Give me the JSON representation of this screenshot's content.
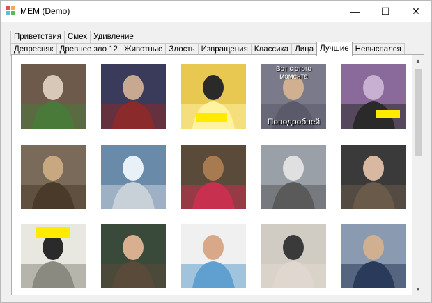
{
  "window": {
    "title": "MEM (Demo)"
  },
  "controls": {
    "minimize": "—",
    "maximize": "☐",
    "close": "✕"
  },
  "tabs_row1": [
    {
      "label": "Приветствия"
    },
    {
      "label": "Смех"
    },
    {
      "label": "Удивление"
    }
  ],
  "tabs_row2": [
    {
      "label": "Депресняк"
    },
    {
      "label": "Древнее зло 12"
    },
    {
      "label": "Животные"
    },
    {
      "label": "Злость"
    },
    {
      "label": "Извращения"
    },
    {
      "label": "Классика"
    },
    {
      "label": "Лица"
    },
    {
      "label": "Лучшие",
      "active": true
    },
    {
      "label": "Невыспался"
    }
  ],
  "memes": [
    {
      "caption_top": "",
      "caption_bottom": ""
    },
    {
      "caption_top": "",
      "caption_bottom": ""
    },
    {
      "caption_top": "",
      "caption_bottom": ""
    },
    {
      "caption_top": "Вот с этого момента",
      "caption_bottom": "Поподробней"
    },
    {
      "caption_top": "",
      "caption_bottom": ""
    },
    {
      "caption_top": "",
      "caption_bottom": ""
    },
    {
      "caption_top": "",
      "caption_bottom": ""
    },
    {
      "caption_top": "",
      "caption_bottom": ""
    },
    {
      "caption_top": "",
      "caption_bottom": ""
    },
    {
      "caption_top": "",
      "caption_bottom": ""
    },
    {
      "caption_top": "",
      "caption_bottom": ""
    },
    {
      "caption_top": "",
      "caption_bottom": ""
    },
    {
      "caption_top": "",
      "caption_bottom": ""
    },
    {
      "caption_top": "",
      "caption_bottom": ""
    },
    {
      "caption_top": "",
      "caption_bottom": ""
    }
  ],
  "colors": {
    "highlight": "#ffea00",
    "panel_border": "#aeaeae",
    "chrome": "#f0f0f0"
  }
}
